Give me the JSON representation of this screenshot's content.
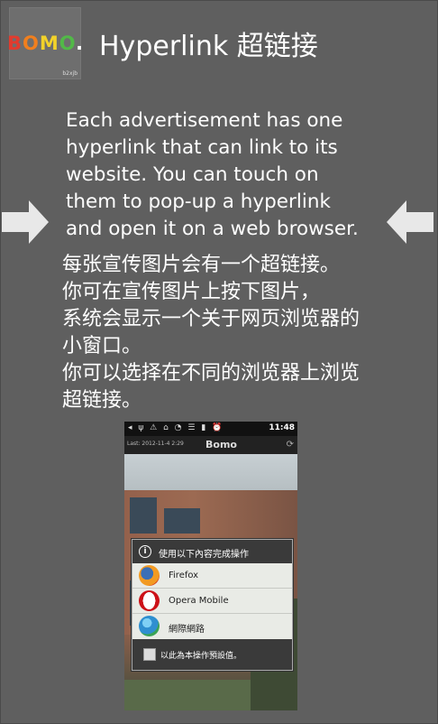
{
  "logo": {
    "letters": [
      "B",
      "O",
      "M",
      "O",
      "."
    ],
    "letter_colors": [
      "#e23b2e",
      "#f07f1e",
      "#f2d22a",
      "#52b848",
      "#ffffff"
    ],
    "sub": "b2xjb"
  },
  "header": {
    "title": "Hyperlink 超链接"
  },
  "body": {
    "en_lines": [
      "Each advertisement has one",
      "hyperlink that can link to its",
      "website. You can touch on",
      "them to pop-up a hyperlink",
      "and open it on a web browser."
    ],
    "zh_lines": [
      "每张宣传图片会有一个超链接。",
      "你可在宣传图片上按下图片，",
      "系统会显示一个关于网页浏览器的",
      "小窗口。",
      "你可以选择在不同的浏览器上浏览",
      "超链接。"
    ]
  },
  "nav": {
    "left_icon": "arrow-right-icon",
    "right_icon": "arrow-left-icon"
  },
  "phone": {
    "status_icons": "◂ ψ ⚠ ⌂ ◔ ☰ ▮ ⏰",
    "time": "11:48",
    "last_updated": "Last: 2012-11-4 2:29",
    "app_name": "Bomo",
    "refresh_icon": "refresh-icon",
    "dialog": {
      "title": "使用以下內容完成操作",
      "options": [
        {
          "label": "Firefox",
          "icon": "firefox-icon",
          "color": "#e66a1f"
        },
        {
          "label": "Opera Mobile",
          "icon": "opera-icon",
          "color": "#cc1017"
        },
        {
          "label": "網際網路",
          "icon": "globe-icon",
          "color": "#2f8fd0"
        }
      ],
      "default_label": "以此為本操作預設值。"
    }
  }
}
